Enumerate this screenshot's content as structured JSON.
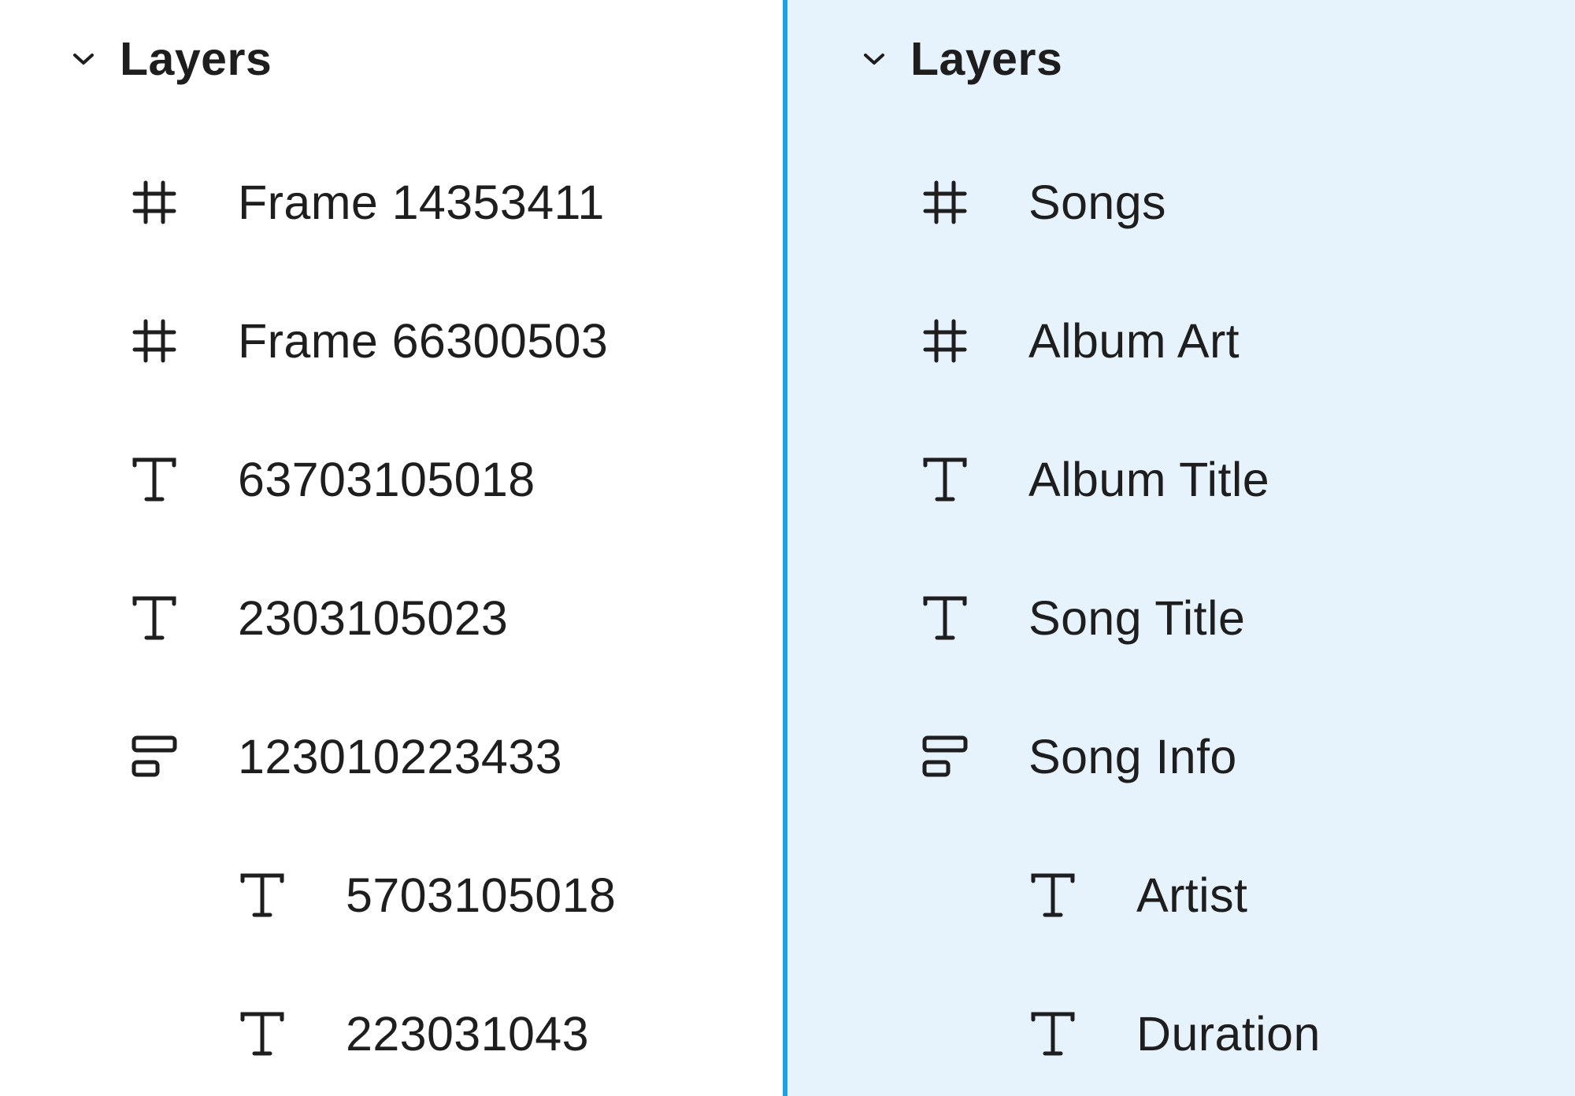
{
  "left_panel": {
    "header": {
      "title": "Layers"
    },
    "layers": [
      {
        "icon": "frame-icon",
        "name": "Frame 14353411",
        "depth": 0
      },
      {
        "icon": "frame-icon",
        "name": "Frame 66300503",
        "depth": 0
      },
      {
        "icon": "text-icon",
        "name": "63703105018",
        "depth": 0
      },
      {
        "icon": "text-icon",
        "name": "2303105023",
        "depth": 0
      },
      {
        "icon": "auto-layout-icon",
        "name": "123010223433",
        "depth": 0
      },
      {
        "icon": "text-icon",
        "name": "5703105018",
        "depth": 1
      },
      {
        "icon": "text-icon",
        "name": "223031043",
        "depth": 1
      }
    ]
  },
  "right_panel": {
    "header": {
      "title": "Layers"
    },
    "layers": [
      {
        "icon": "frame-icon",
        "name": "Songs",
        "depth": 0
      },
      {
        "icon": "frame-icon",
        "name": "Album Art",
        "depth": 0
      },
      {
        "icon": "text-icon",
        "name": "Album Title",
        "depth": 0
      },
      {
        "icon": "text-icon",
        "name": "Song Title",
        "depth": 0
      },
      {
        "icon": "auto-layout-icon",
        "name": "Song Info",
        "depth": 0
      },
      {
        "icon": "text-icon",
        "name": "Artist",
        "depth": 1
      },
      {
        "icon": "text-icon",
        "name": "Duration",
        "depth": 1
      }
    ]
  },
  "colors": {
    "divider": "#1aa1e6",
    "right_background": "#e6f3fc",
    "text": "#1e1e1e"
  }
}
